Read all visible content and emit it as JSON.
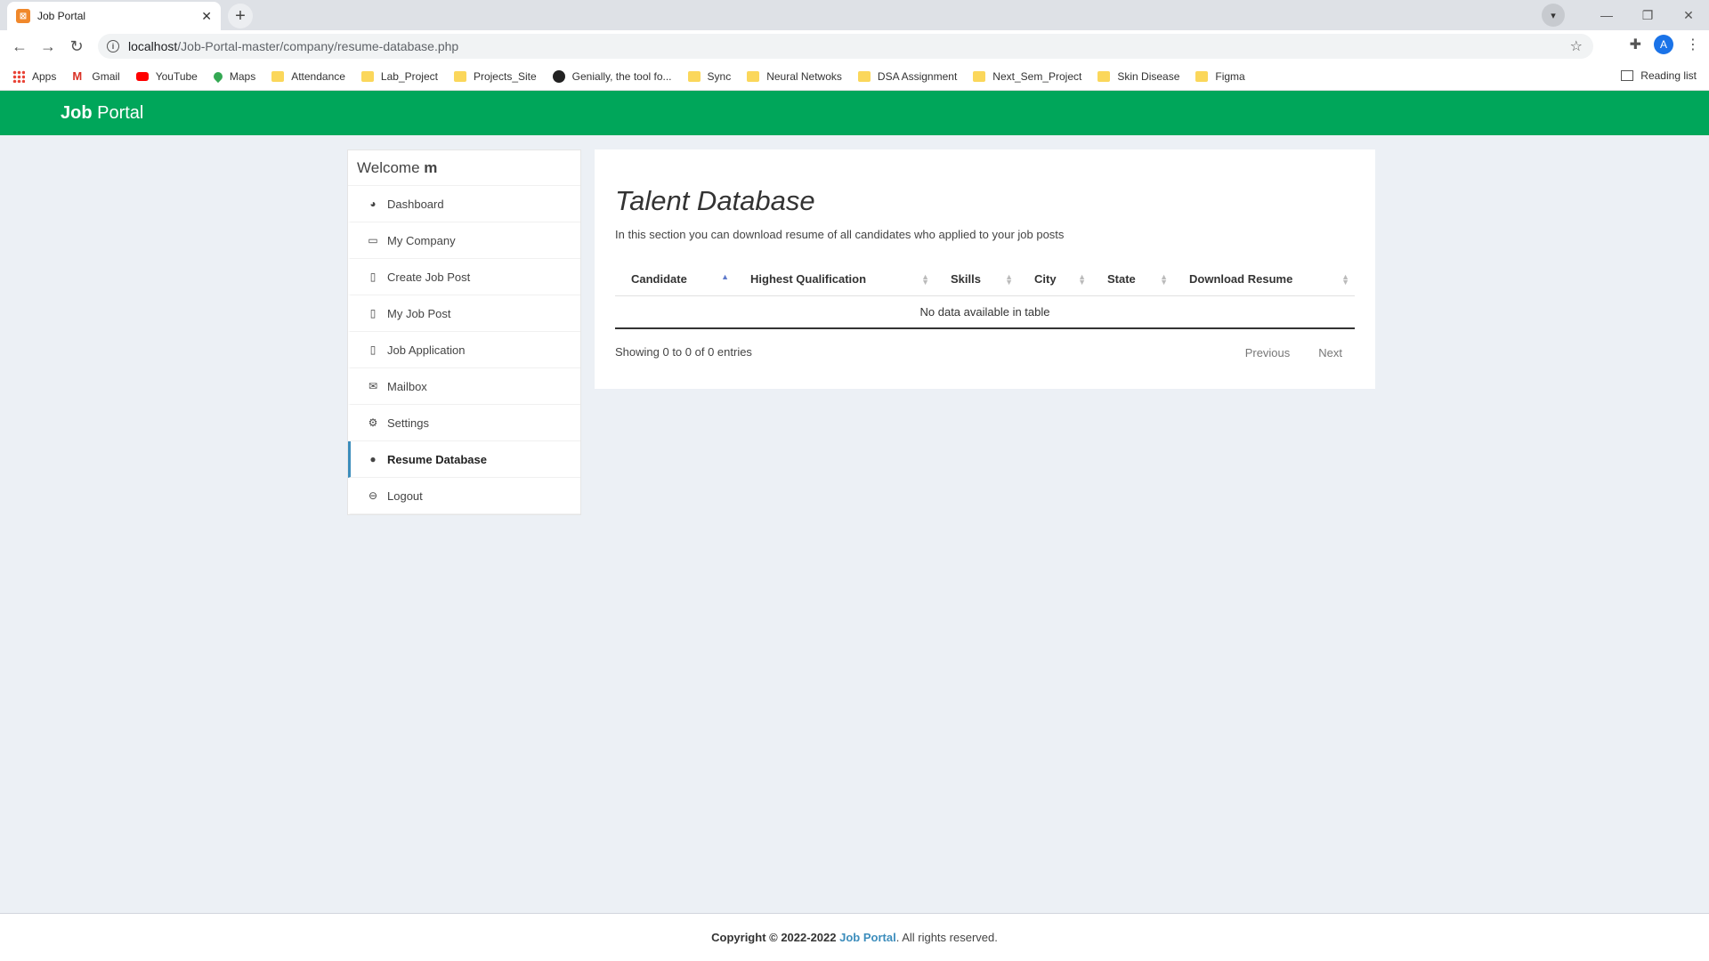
{
  "browser": {
    "tab_title": "Job Portal",
    "url_host": "localhost",
    "url_path": "/Job-Portal-master/company/resume-database.php",
    "avatar_letter": "A",
    "bookmarks": [
      "Apps",
      "Gmail",
      "YouTube",
      "Maps",
      "Attendance",
      "Lab_Project",
      "Projects_Site",
      "Genially, the tool fo...",
      "Sync",
      "Neural Netwoks",
      "DSA Assignment",
      "Next_Sem_Project",
      "Skin Disease",
      "Figma"
    ],
    "reading_list": "Reading list"
  },
  "header": {
    "brand_bold": "Job",
    "brand_rest": " Portal",
    "color": "#00a65a"
  },
  "sidebar": {
    "welcome": "Welcome",
    "username": "m",
    "items": [
      {
        "label": "Dashboard",
        "icon": "dashboard-icon"
      },
      {
        "label": "My Company",
        "icon": "monitor-icon"
      },
      {
        "label": "Create Job Post",
        "icon": "file-icon"
      },
      {
        "label": "My Job Post",
        "icon": "file-icon"
      },
      {
        "label": "Job Application",
        "icon": "file-icon"
      },
      {
        "label": "Mailbox",
        "icon": "envelope-icon"
      },
      {
        "label": "Settings",
        "icon": "gear-icon"
      },
      {
        "label": "Resume Database",
        "icon": "user-icon"
      },
      {
        "label": "Logout",
        "icon": "logout-icon"
      }
    ]
  },
  "main": {
    "title": "Talent Database",
    "description": "In this section you can download resume of all candidates who applied to your job posts",
    "columns": [
      "Candidate",
      "Highest Qualification",
      "Skills",
      "City",
      "State",
      "Download Resume"
    ],
    "empty": "No data available in table",
    "showing": "Showing 0 to 0 of 0 entries",
    "prev": "Previous",
    "next": "Next"
  },
  "footer": {
    "prefix": "Copyright © 2022-2022 ",
    "link": "Job Portal",
    "suffix": ". All rights reserved."
  }
}
